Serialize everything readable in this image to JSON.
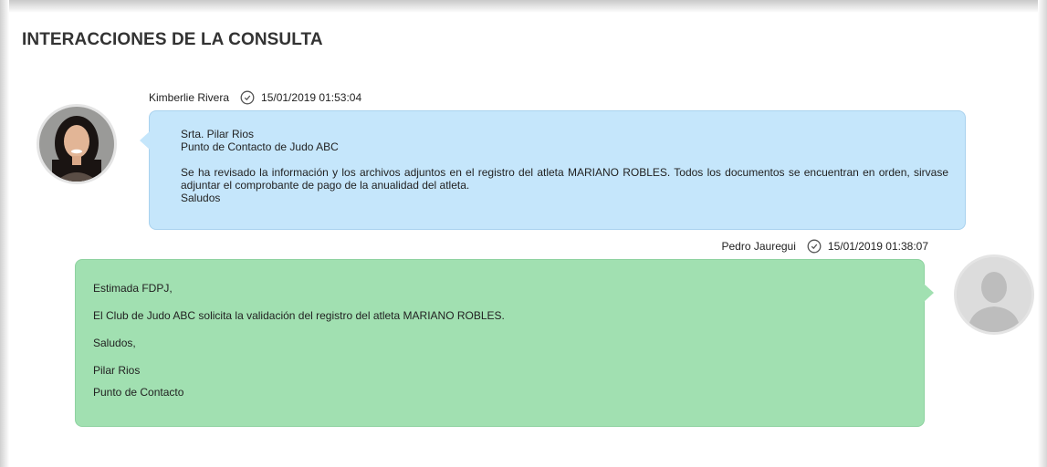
{
  "page": {
    "title": "INTERACCIONES DE LA CONSULTA"
  },
  "messages": [
    {
      "author": "Kimberlie Rivera",
      "timestamp": "15/01/2019 01:53:04",
      "lines": [
        "Srta. Pilar Rios",
        "Punto de Contacto de Judo ABC"
      ],
      "body": "Se ha revisado la información y los archivos adjuntos en el registro del atleta MARIANO ROBLES. Todos los documentos se encuentran en orden, sirvase adjuntar el comprobante de pago de la anualidad del atleta.",
      "closing": "Saludos",
      "bubble_color": "#c5e6fb",
      "avatar": "user-photo-avatar"
    },
    {
      "author": "Pedro Jauregui",
      "timestamp": "15/01/2019 01:38:07",
      "lines": [
        "Estimada FDPJ,",
        "El Club de Judo ABC solicita la validación del registro del atleta MARIANO ROBLES.",
        "Saludos,",
        "Pilar Rios",
        "Punto de Contacto"
      ],
      "bubble_color": "#a1e0b1",
      "avatar": "default-user-avatar"
    }
  ],
  "icons": {
    "timestamp": "clock-icon"
  }
}
